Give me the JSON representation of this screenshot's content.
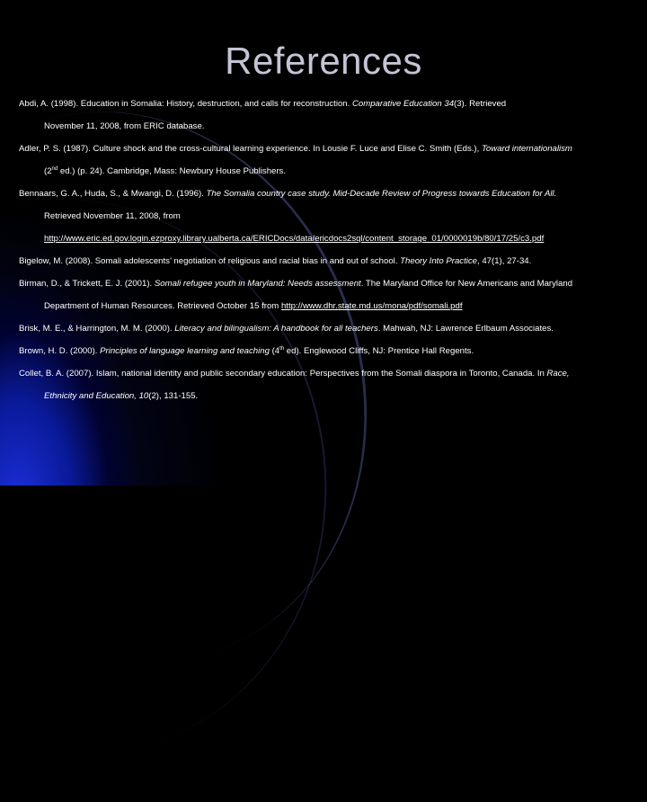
{
  "slide": {
    "title": "References"
  },
  "references": [
    {
      "lines": [
        {
          "segments": [
            {
              "text": "Abdi, A. (1998). Education in Somalia: History, destruction, and calls for reconstruction. "
            },
            {
              "text": "Comparative Education 34",
              "style": "italic"
            },
            {
              "text": "(3). Retrieved"
            }
          ]
        },
        {
          "segments": [
            {
              "text": "November 11, 2008, from ERIC database."
            }
          ]
        }
      ]
    },
    {
      "lines": [
        {
          "segments": [
            {
              "text": "Adler, P. S. (1987). Culture shock and the cross-cultural learning experience. In Lousie F. Luce and Elise C. Smith (Eds.), "
            },
            {
              "text": "Toward internationalism",
              "style": "italic"
            }
          ]
        },
        {
          "segments": [
            {
              "text": "(2"
            },
            {
              "text": "nd",
              "style": "sup"
            },
            {
              "text": " ed.) (p. 24). Cambridge, Mass: Newbury House Publishers."
            }
          ]
        }
      ]
    },
    {
      "lines": [
        {
          "segments": [
            {
              "text": "Bennaars, G. A., Huda, S., & Mwangi, D. (1996). "
            },
            {
              "text": "The Somalia country case study. Mid-Decade Review of Progress towards Education for All.",
              "style": "italic"
            }
          ]
        },
        {
          "segments": [
            {
              "text": "Retrieved November 11, 2008, from"
            }
          ]
        },
        {
          "segments": [
            {
              "text": "http://www.eric.ed.gov.login.ezproxy.library.ualberta.ca/ERICDocs/data/ericdocs2sql/content_storage_01/0000019b/80/17/25/c3.pdf",
              "style": "link"
            }
          ]
        }
      ]
    },
    {
      "lines": [
        {
          "segments": [
            {
              "text": "Bigelow, M. (2008). Somali  adolescents’ negotiation of religious and racial bias in and out of school. "
            },
            {
              "text": "Theory Into Practice",
              "style": "italic"
            },
            {
              "text": ", 47(1), 27-34."
            }
          ]
        }
      ]
    },
    {
      "lines": [
        {
          "segments": [
            {
              "text": "Birman, D., & Trickett, E. J. (2001).  "
            },
            {
              "text": "Somali refugee youth in Maryland: Needs assessment",
              "style": "italic"
            },
            {
              "text": ". The Maryland Office for New Americans and Maryland"
            }
          ]
        },
        {
          "segments": [
            {
              "text": "Department of Human Resources. Retrieved October 15 from "
            },
            {
              "text": "http://www.dhr.state.md.us/mona/pdf/somali.pdf",
              "style": "link"
            }
          ]
        }
      ]
    },
    {
      "lines": [
        {
          "segments": [
            {
              "text": "Brisk, M. E., & Harrington, M. M. (2000). "
            },
            {
              "text": "Literacy and bilingualism: A handbook for all teachers",
              "style": "italic"
            },
            {
              "text": ". Mahwah, NJ: Lawrence Erlbaum Associates."
            }
          ]
        }
      ]
    },
    {
      "lines": [
        {
          "segments": [
            {
              "text": "Brown, H. D. (2000). "
            },
            {
              "text": "Principles of language learning and teaching",
              "style": "italic"
            },
            {
              "text": " (4"
            },
            {
              "text": "th",
              "style": "sup"
            },
            {
              "text": " ed). Englewood Cliffs, NJ: Prentice Hall Regents."
            }
          ]
        }
      ]
    },
    {
      "lines": [
        {
          "segments": [
            {
              "text": "Collet, B. A. (2007). Islam, national identity and public secondary education: Perspectives from the Somali diaspora in Toronto, Canada. In "
            },
            {
              "text": "Race,",
              "style": "italic"
            }
          ]
        },
        {
          "segments": [
            {
              "text": "Ethnicity and Education, 10",
              "style": "italic"
            },
            {
              "text": "(2), 131-155."
            }
          ]
        }
      ]
    }
  ]
}
